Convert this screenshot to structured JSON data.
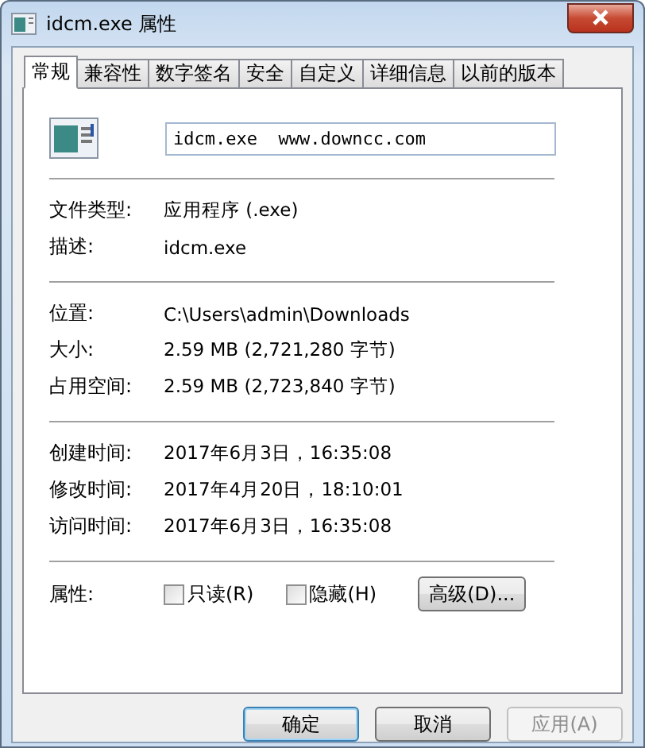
{
  "window": {
    "title": "idcm.exe 属性"
  },
  "tabs": [
    {
      "label": "常规",
      "selected": true
    },
    {
      "label": "兼容性",
      "selected": false
    },
    {
      "label": "数字签名",
      "selected": false
    },
    {
      "label": "安全",
      "selected": false
    },
    {
      "label": "自定义",
      "selected": false
    },
    {
      "label": "详细信息",
      "selected": false
    },
    {
      "label": "以前的版本",
      "selected": false
    }
  ],
  "file": {
    "name": "idcm.exe  www.downcc.com"
  },
  "sections": [
    [
      {
        "label": "文件类型:",
        "value": "应用程序 (.exe)"
      },
      {
        "label": "描述:",
        "value": "idcm.exe"
      }
    ],
    [
      {
        "label": "位置:",
        "value": "C:\\Users\\admin\\Downloads"
      },
      {
        "label": "大小:",
        "value": "2.59 MB (2,721,280 字节)"
      },
      {
        "label": "占用空间:",
        "value": "2.59 MB (2,723,840 字节)"
      }
    ],
    [
      {
        "label": "创建时间:",
        "value": "2017年6月3日，16:35:08"
      },
      {
        "label": "修改时间:",
        "value": "2017年4月20日，18:10:01"
      },
      {
        "label": "访问时间:",
        "value": "2017年6月3日，16:35:08"
      }
    ]
  ],
  "attributes": {
    "label": "属性:",
    "options": [
      {
        "label": "只读(R)",
        "checked": false
      },
      {
        "label": "隐藏(H)",
        "checked": false
      }
    ],
    "advanced_button": "高级(D)..."
  },
  "buttons": [
    {
      "label": "确定",
      "default": true,
      "disabled": false
    },
    {
      "label": "取消",
      "default": false,
      "disabled": false
    },
    {
      "label": "应用(A)",
      "default": false,
      "disabled": true
    }
  ]
}
